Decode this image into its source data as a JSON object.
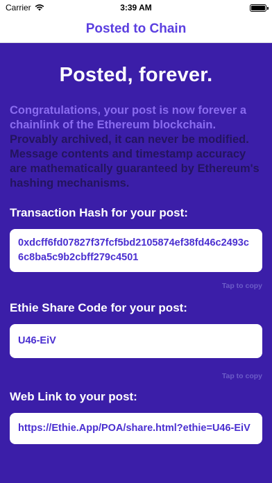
{
  "status_bar": {
    "carrier": "Carrier",
    "time": "3:39 AM"
  },
  "nav": {
    "title": "Posted to Chain"
  },
  "main": {
    "headline": "Posted, forever.",
    "congrats_text": "Congratulations, your post is now forever a chainlink of the Ethereum blockchain.",
    "archived_text": "Provably archived, it can never be modified. Message contents and timestamp accuracy are mathematically guaranteed by Ethereum's hashing mechanisms.",
    "tx_label": "Transaction Hash for your post:",
    "tx_hash": "0xdcff6fd07827f37fcf5bd2105874ef38fd46c2493c6c8ba5c9b2cbff279c4501",
    "tx_copy": "Tap to copy",
    "share_label": "Ethie Share Code for your post:",
    "share_code": "U46-EiV",
    "share_copy": "Tap to copy",
    "link_label": "Web Link to your post:",
    "web_link": "https://Ethie.App/POA/share.html?ethie=U46-EiV"
  },
  "colors": {
    "accent": "#5b3fe0",
    "background": "#3b1ea8",
    "highlight_text": "#8a6cf0",
    "dim_text": "#23145e"
  }
}
